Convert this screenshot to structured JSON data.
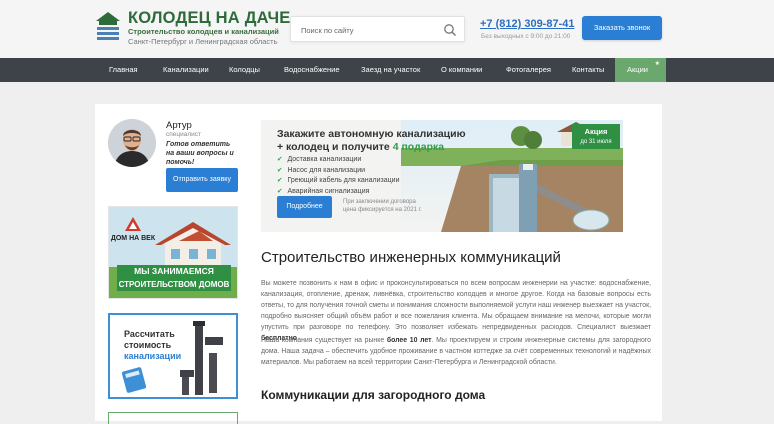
{
  "header": {
    "logo_title": "КОЛОДЕЦ НА ДАЧЕ",
    "logo_subtitle": "Строительство колодцев и канализаций",
    "logo_region": "Санкт-Петербург и Ленинградская область",
    "search_placeholder": "Поиск по сайту",
    "phone": "+7 (812) 309-87-41",
    "hours": "Без выходных с 9:00 до 21:00",
    "call_button": "Заказать звонок"
  },
  "nav": {
    "items": [
      "Главная",
      "Канализации",
      "Колодцы",
      "Водоснабжение",
      "Заезд на участок",
      "О компании",
      "Фотогалерея",
      "Контакты",
      "Акции"
    ]
  },
  "sidebar": {
    "agent_name": "Артур",
    "agent_role": "специалист",
    "agent_note": "Готов ответить на ваши вопросы и помочь!",
    "request_button": "Отправить заявку",
    "banner_house_brand": "ДОМ НА ВЕК",
    "banner_house_text1": "МЫ ЗАНИМАЕМСЯ",
    "banner_house_text2": "СТРОИТЕЛЬСТВОМ ДОМОВ",
    "banner_calc_line1": "Рассчитать",
    "banner_calc_line2": "стоимость",
    "banner_calc_line3": "канализации"
  },
  "hero": {
    "title_line1": "Закажите автономную канализацию",
    "title_line2_prefix": "+ колодец и получите ",
    "title_line2_accent": "4 подарка",
    "list": [
      "Доставка канализации",
      "Насос для канализации",
      "Греющий кабель для канализации",
      "Аварийная сигнализация"
    ],
    "button": "Подробнее",
    "note": "При заключении договора цена фиксируется на 2021 г.",
    "badge_title": "Акция",
    "badge_date": "до 31 июля"
  },
  "main": {
    "heading": "Строительство инженерных коммуникаций",
    "p1": "Вы можете позвонить к нам в офис и проконсультироваться по всем вопросам инженерии на участке: водоснабжение, канализация, отопление, дренаж, ливнёвка, строительство колодцев и многое другое. Когда на базовые вопросы есть ответы, то для получения точной сметы и понимания сложности выполняемой услуги наш инженер выезжает на участок, подробно выясняет общий объём работ и все пожелания клиента. Мы обращаем внимание на мелочи, которые могли упустить при разговоре по телефону. Это позволяет избежать непредвиденных расходов. Специалист выезжает ",
    "p1_bold": "бесплатно",
    "p1_end": ".",
    "p2_a": "Наша компания существует на рынке ",
    "p2_bold": "более 10 лет",
    "p2_b": ". Мы проектируем и строим инженерные системы для загородного дома. Наша задача – обеспечить удобное проживание в частном коттедже за счёт современных технологий и надёжных материалов. Мы работаем на всей территории Санкт-Петербурга и Ленинградской области.",
    "subheading": "Коммуникации для загородного дома"
  }
}
